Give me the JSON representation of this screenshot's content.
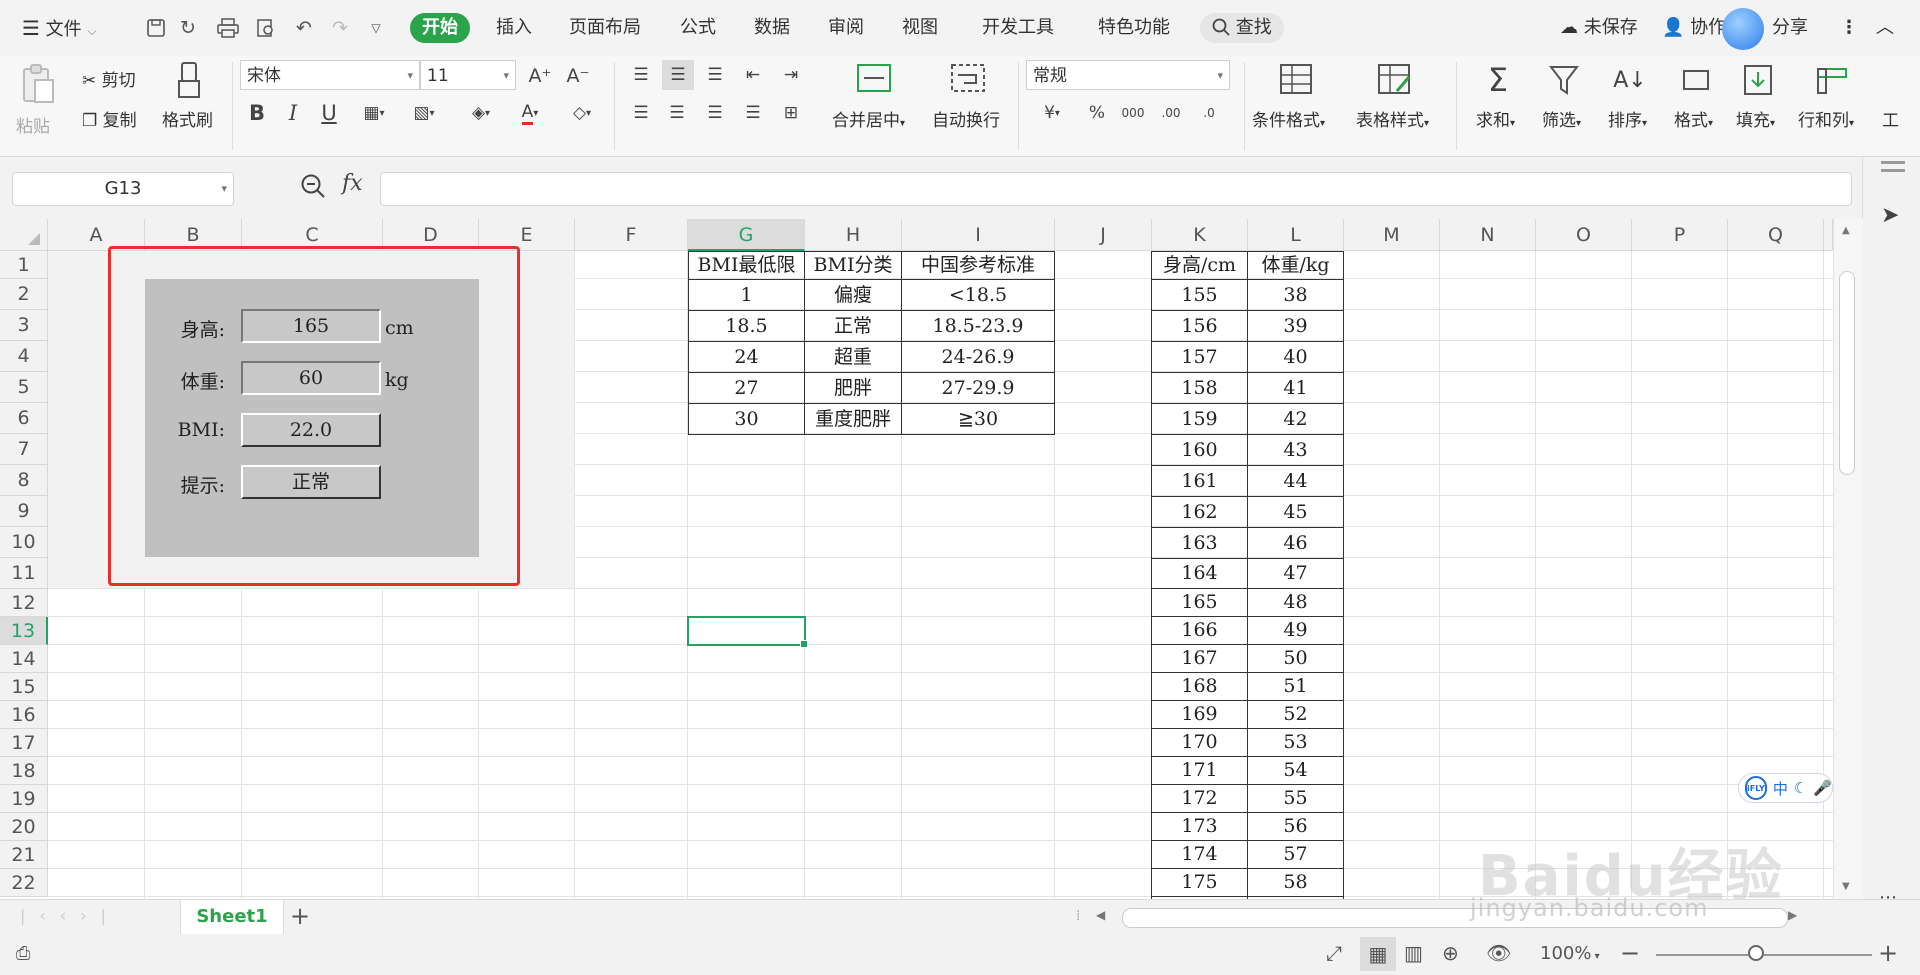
{
  "menubar": {
    "file_label": "文件",
    "tabs": [
      "开始",
      "插入",
      "页面布局",
      "公式",
      "数据",
      "审阅",
      "视图",
      "开发工具",
      "特色功能"
    ],
    "search_label": "查找",
    "unsaved_label": "未保存",
    "collab_label": "协作",
    "share_label": "分享"
  },
  "ribbon": {
    "paste": "粘贴",
    "cut": "剪切",
    "copy": "复制",
    "format_painter": "格式刷",
    "font_name": "宋体",
    "font_size": "11",
    "merge_center": "合并居中",
    "wrap_text": "自动换行",
    "number_format": "常规",
    "conditional_format": "条件格式",
    "table_style": "表格样式",
    "sum": "求和",
    "filter": "筛选",
    "sort": "排序",
    "format": "格式",
    "fill": "填充",
    "rows_cols": "行和列",
    "work": "工"
  },
  "formula_bar": {
    "name_box": "G13",
    "fx": "fx",
    "formula": ""
  },
  "grid": {
    "columns": [
      "A",
      "B",
      "C",
      "D",
      "E",
      "F",
      "G",
      "H",
      "I",
      "J",
      "K",
      "L",
      "M",
      "N",
      "O",
      "P",
      "Q"
    ],
    "selected_column": "G",
    "selected_row": "13",
    "rows": [
      "1",
      "2",
      "3",
      "4",
      "5",
      "6",
      "7",
      "8",
      "9",
      "10",
      "11",
      "12",
      "13",
      "14",
      "15",
      "16",
      "17",
      "18",
      "19",
      "20",
      "21",
      "22"
    ]
  },
  "bmi_form": {
    "height_label": "身高:",
    "height_value": "165",
    "height_unit": "cm",
    "weight_label": "体重:",
    "weight_value": "60",
    "weight_unit": "kg",
    "bmi_label": "BMI:",
    "bmi_value": "22.0",
    "hint_label": "提示:",
    "hint_value": "正常",
    "highlight_color": "#e8302a"
  },
  "bmi_table": {
    "headers": [
      "BMI最低限",
      "BMI分类",
      "中国参考标准"
    ],
    "rows": [
      [
        "1",
        "偏瘦",
        "<18.5"
      ],
      [
        "18.5",
        "正常",
        "18.5-23.9"
      ],
      [
        "24",
        "超重",
        "24-26.9"
      ],
      [
        "27",
        "肥胖",
        "27-29.9"
      ],
      [
        "30",
        "重度肥胖",
        "≧30"
      ]
    ]
  },
  "hw_table": {
    "headers": [
      "身高/cm",
      "体重/kg"
    ],
    "rows": [
      [
        "155",
        "38"
      ],
      [
        "156",
        "39"
      ],
      [
        "157",
        "40"
      ],
      [
        "158",
        "41"
      ],
      [
        "159",
        "42"
      ],
      [
        "160",
        "43"
      ],
      [
        "161",
        "44"
      ],
      [
        "162",
        "45"
      ],
      [
        "163",
        "46"
      ],
      [
        "164",
        "47"
      ],
      [
        "165",
        "48"
      ],
      [
        "166",
        "49"
      ],
      [
        "167",
        "50"
      ],
      [
        "168",
        "51"
      ],
      [
        "169",
        "52"
      ],
      [
        "170",
        "53"
      ],
      [
        "171",
        "54"
      ],
      [
        "172",
        "55"
      ],
      [
        "173",
        "56"
      ],
      [
        "174",
        "57"
      ],
      [
        "175",
        "58"
      ]
    ]
  },
  "sheetbar": {
    "sheet_name": "Sheet1",
    "add": "+"
  },
  "statusbar": {
    "zoom": "100%"
  },
  "ime": {
    "logo": "iFLY",
    "lang": "中"
  },
  "watermark": {
    "brand": "Baidu经验",
    "url": "jingyan.baidu.com"
  },
  "colors": {
    "accent": "#2aa34a",
    "selection": "#21a366",
    "form_bg": "#c0c0c0"
  }
}
